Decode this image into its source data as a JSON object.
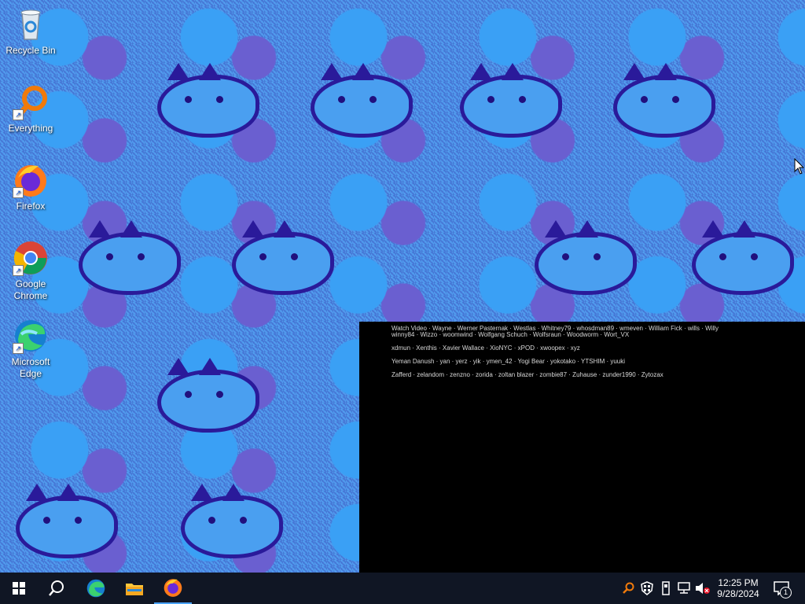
{
  "desktop": {
    "icons": [
      {
        "label": "Recycle Bin"
      },
      {
        "label": "Everything"
      },
      {
        "label": "Firefox"
      },
      {
        "label": "Google Chrome"
      },
      {
        "label": "Microsoft Edge"
      }
    ]
  },
  "credits": {
    "lines": [
      "Watch Video  ·  Wayne  ·  Werner Pasternak  ·  Westlas  ·  Whitney79  ·  whosdman89  ·  wmeven  ·  William Fick  ·  wills  ·  Willy",
      "winny84  ·  Wizzo  ·  woomwind  ·  Wolfgang Schuch  ·  Wolfsraun  ·  Woodworm  ·  Wort_VX",
      "xdmun  ·  Xenthis  ·  Xavier Wallace  ·  XioNYC  ·  xPOD  ·  xwoopex  ·  xyz",
      "Yeman Danush  ·  yan  ·  yerz  ·  yik  ·  ymen_42  ·  Yogi Bear  ·  yokotako  ·  YTSHIM  ·  yuuki",
      "Zafferd  ·  zelandom  ·  zenzno  ·  zorida  ·  zoltan blazer  ·  zombie87  ·  Zuhause  ·  zunder1990  ·  Zytozax"
    ]
  },
  "taskbar": {
    "time": "12:25 PM",
    "date": "9/28/2024",
    "notification_count": "1"
  }
}
